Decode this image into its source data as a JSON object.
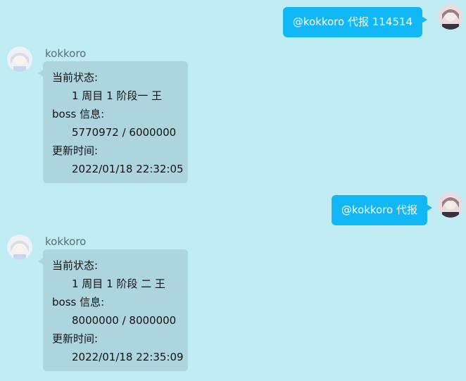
{
  "messages": [
    {
      "type": "outgoing",
      "text": "@kokkoro 代报 114514"
    },
    {
      "type": "incoming",
      "sender": "kokkoro",
      "lines": [
        "当前状态:",
        "1 周目 1 阶段一 王",
        "boss 信息:",
        "5770972 / 6000000",
        "更新时间:",
        "2022/01/18 22:32:05"
      ]
    },
    {
      "type": "outgoing",
      "text": "@kokkoro 代报"
    },
    {
      "type": "incoming",
      "sender": "kokkoro",
      "lines": [
        "当前状态:",
        "1 周目 1 阶段 二 王",
        "boss 信息:",
        "8000000 / 8000000",
        "更新时间:",
        "2022/01/18 22:35:09"
      ]
    }
  ],
  "colors": {
    "background": "#c0ecf4",
    "outgoing_bubble": "#12b7f5",
    "incoming_bubble": "#acd5de"
  },
  "icons": {
    "user_avatar": "user-avatar-icon",
    "bot_avatar": "kokkoro-avatar-icon"
  }
}
